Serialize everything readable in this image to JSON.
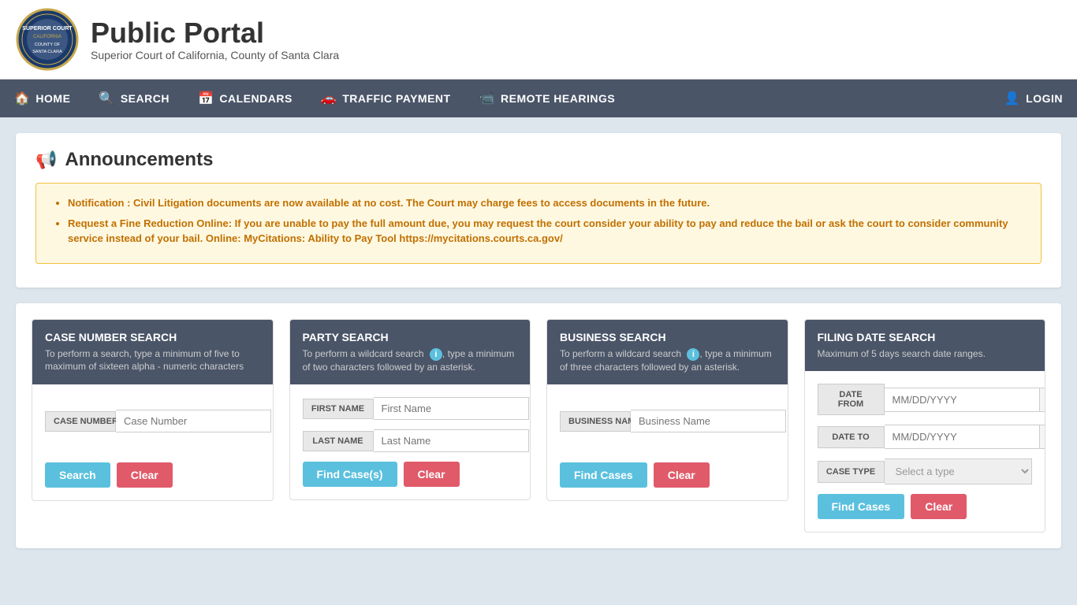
{
  "header": {
    "title": "Public Portal",
    "subtitle": "Superior Court of California, County of Santa Clara",
    "logo_alt": "Court Seal"
  },
  "nav": {
    "items": [
      {
        "id": "home",
        "label": "HOME",
        "icon": "🏠"
      },
      {
        "id": "search",
        "label": "SEARCH",
        "icon": "🔍"
      },
      {
        "id": "calendars",
        "label": "CALENDARS",
        "icon": "📅"
      },
      {
        "id": "traffic-payment",
        "label": "TRAFFIC PAYMENT",
        "icon": "🚗"
      },
      {
        "id": "remote-hearings",
        "label": "REMOTE HEARINGS",
        "icon": "📹"
      }
    ],
    "login_label": "LOGIN",
    "login_icon": "👤"
  },
  "announcements": {
    "title": "Announcements",
    "items": [
      "Notification : Civil Litigation documents are now available at no cost. The Court may charge fees to access documents in the future.",
      "Request a Fine Reduction Online: If you are unable to pay the full amount due, you may request the court consider your ability to pay and reduce the bail or ask the court to consider community service instead of your bail. Online: MyCitations: Ability to Pay Tool https://mycitations.courts.ca.gov/"
    ]
  },
  "case_number_search": {
    "title": "CASE NUMBER SEARCH",
    "description": "To perform a search, type a minimum of five to maximum of sixteen alpha - numeric characters",
    "field_label": "CASE NUMBER",
    "field_placeholder": "Case Number",
    "search_btn": "Search",
    "clear_btn": "Clear"
  },
  "party_search": {
    "title": "PARTY SEARCH",
    "description": "To perform a wildcard search , type a minimum of two characters followed by an asterisk.",
    "first_name_label": "FIRST NAME",
    "first_name_placeholder": "First Name",
    "last_name_label": "LAST NAME",
    "last_name_placeholder": "Last Name",
    "find_btn": "Find Case(s)",
    "clear_btn": "Clear"
  },
  "business_search": {
    "title": "BUSINESS SEARCH",
    "description": "To perform a wildcard search , type a minimum of three characters followed by an asterisk.",
    "field_label": "BUSINESS NAME",
    "field_placeholder": "Business Name",
    "find_btn": "Find Cases",
    "clear_btn": "Clear"
  },
  "filing_date_search": {
    "title": "FILING DATE SEARCH",
    "description": "Maximum of 5 days search date ranges.",
    "date_from_label": "DATE FROM",
    "date_from_placeholder": "MM/DD/YYYY",
    "date_to_label": "DATE TO",
    "date_to_placeholder": "MM/DD/YYYY",
    "case_type_label": "CASE TYPE",
    "case_type_placeholder": "Select a type",
    "find_btn": "Find Cases",
    "clear_btn": "Clear"
  }
}
